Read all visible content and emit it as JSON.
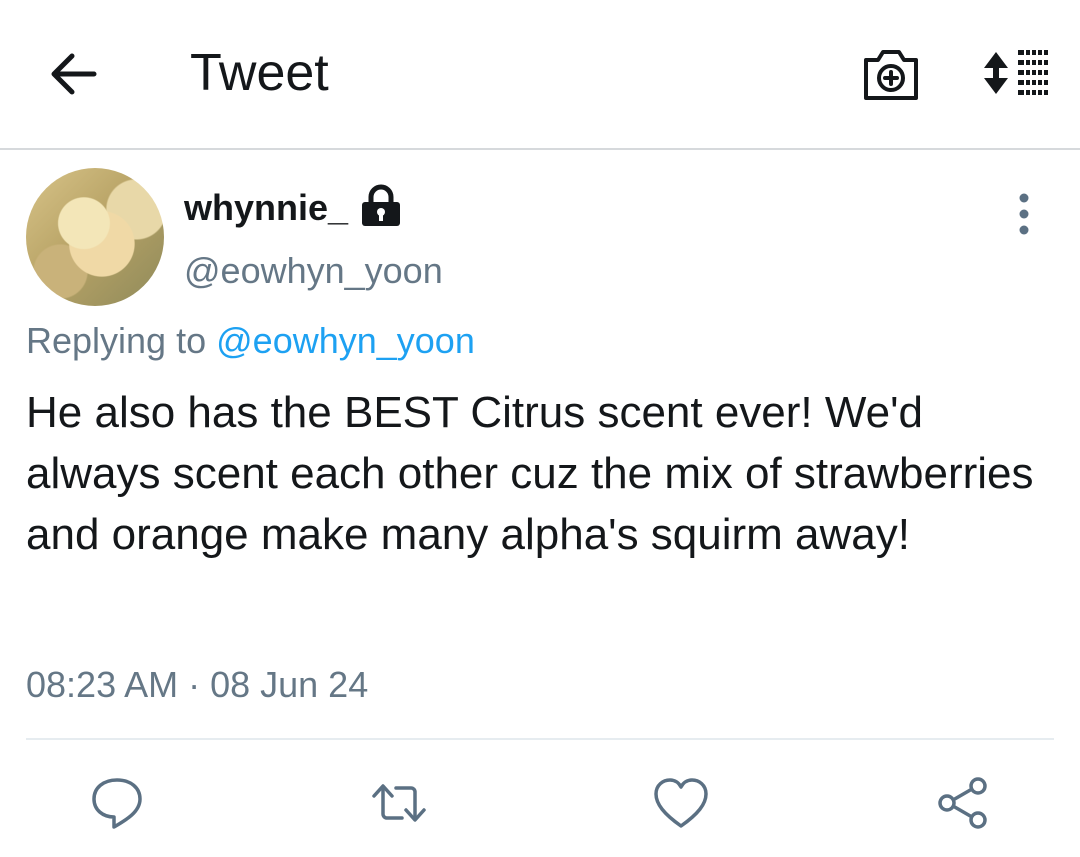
{
  "header": {
    "title": "Tweet",
    "icons": {
      "back": "arrow-left-icon",
      "camera": "camera-add-icon",
      "sort": "sort-icon"
    }
  },
  "tweet": {
    "display_name": "whynnie_",
    "handle": "@eowhyn_yoon",
    "protected": true,
    "reply": {
      "prefix": "Replying to",
      "mention": "@eowhyn_yoon"
    },
    "text": "He also has the BEST Citrus scent ever! We'd always scent each other cuz the mix of strawberries and orange make many alpha's squirm away!",
    "timestamp": "08:23 AM · 08 Jun 24"
  },
  "actions": [
    "reply-icon",
    "retweet-icon",
    "like-icon",
    "share-icon"
  ],
  "colors": {
    "text": "#14171a",
    "secondary": "#657786",
    "accent": "#1da1f2",
    "icon": "#5b7083",
    "divider": "#e6ecf0"
  }
}
